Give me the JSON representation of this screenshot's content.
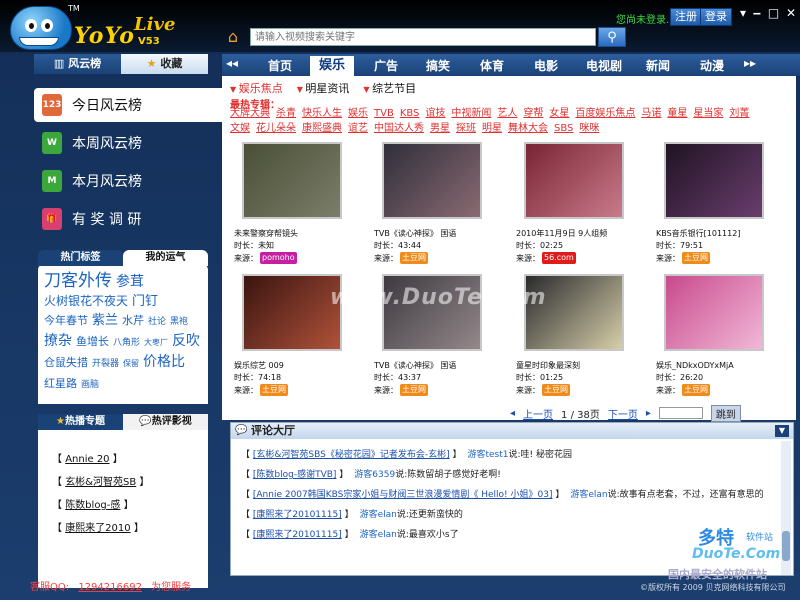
{
  "app": {
    "logo_text": "YoYo",
    "logo_live": "Live",
    "version": "V53",
    "tm": "TM"
  },
  "header": {
    "search_placeholder": "请输入视频搜索关键字",
    "login_msg": "您尚未登录...",
    "register": "注册",
    "login": "登录"
  },
  "sidebar": {
    "tabs": [
      "风云榜",
      "收藏"
    ],
    "rank_items": [
      {
        "label": "今日风云榜",
        "icon": "calendar-today-icon",
        "icon_text": "123",
        "color": "#e0683a"
      },
      {
        "label": "本周风云榜",
        "icon": "calendar-week-icon",
        "icon_text": "W",
        "color": "#3aa83a"
      },
      {
        "label": "本月风云榜",
        "icon": "calendar-month-icon",
        "icon_text": "M",
        "color": "#3aa83a"
      },
      {
        "label": "有 奖 调 研",
        "icon": "gift-icon",
        "icon_text": "🎁",
        "color": "#d84070"
      }
    ],
    "tags_tabs": [
      "热门标签",
      "我的运气"
    ],
    "tags": [
      {
        "t": "刀客外传",
        "s": 17
      },
      {
        "t": "参茸",
        "s": 14
      },
      {
        "t": "火树银花不夜天",
        "s": 12
      },
      {
        "t": "门钉",
        "s": 13
      },
      {
        "t": "今年春节",
        "s": 11
      },
      {
        "t": "紫兰",
        "s": 13
      },
      {
        "t": "水芹",
        "s": 11
      },
      {
        "t": "社论",
        "s": 9
      },
      {
        "t": "黑袍",
        "s": 9
      },
      {
        "t": "撩杂",
        "s": 14
      },
      {
        "t": "鱼增长",
        "s": 11
      },
      {
        "t": "八角形",
        "s": 9
      },
      {
        "t": "大枣厂",
        "s": 8
      },
      {
        "t": "反吹",
        "s": 14
      },
      {
        "t": "仓鼠失措",
        "s": 11
      },
      {
        "t": "开裂器",
        "s": 9
      },
      {
        "t": "保留",
        "s": 8
      },
      {
        "t": "价格比",
        "s": 14
      },
      {
        "t": "红星路",
        "s": 11
      },
      {
        "t": "画脑",
        "s": 9
      }
    ],
    "topics_tabs": [
      "热播专题",
      "热评影视"
    ],
    "topics": [
      "Annie 20",
      "玄彬&河智苑SB",
      "陈数blog-感",
      "康熙来了2010"
    ]
  },
  "status": {
    "qq_label": "客服QQ:",
    "qq": "1294216692",
    "service": "为您服务"
  },
  "copyright": "©版权所有 2009 贝克网络科技有限公司",
  "main_tabs": [
    "首页",
    "娱乐",
    "广告",
    "搞笑",
    "体育",
    "电影",
    "电视剧",
    "新闻",
    "动漫"
  ],
  "content": {
    "subtabs": [
      "娱乐焦点",
      "明星资讯",
      "综艺节目"
    ],
    "specials_label": "最热专辑：",
    "specials": [
      "大牌大典",
      "杀青",
      "快乐人生",
      "娱乐",
      "TVB",
      "KBS",
      "谊技",
      "中视新闻",
      "艺人",
      "穿帮",
      "女星",
      "百度娱乐焦点",
      "马诺",
      "童星",
      "星当家",
      "刘菁",
      "文娱",
      "花儿朵朵",
      "康熙盛典",
      "谊艺",
      "中国达人秀",
      "男星",
      "探班",
      "明星",
      "舞林大会",
      "SBS",
      "咪咪"
    ],
    "videos": [
      {
        "title": "未来警察穿帮镜头",
        "dur": "时长：未知",
        "src": "来源：",
        "logo": "pomoho",
        "colors": [
          "#4a4f36",
          "#7b7e6a"
        ]
      },
      {
        "title": "TVB《读心神探》 国语",
        "dur": "时长：43:44",
        "src": "来源：",
        "logo": "土豆网",
        "colors": [
          "#2f2f3b",
          "#8a6a72"
        ]
      },
      {
        "title": "2010年11月9日 9人组频",
        "dur": "时长：02:25",
        "src": "来源：",
        "logo": "56.com",
        "colors": [
          "#7a2434",
          "#c97b8b"
        ]
      },
      {
        "title": "KBS音乐银行[101112]",
        "dur": "时长：79:51",
        "src": "来源：",
        "logo": "土豆网",
        "colors": [
          "#1e1422",
          "#6a3d6e"
        ]
      },
      {
        "title": "娱乐综艺 009",
        "dur": "时长：74:18",
        "src": "来源：",
        "logo": "土豆网",
        "colors": [
          "#3a1410",
          "#b0523a"
        ]
      },
      {
        "title": "TVB《读心神探》 国语",
        "dur": "时长：43:37",
        "src": "来源：",
        "logo": "土豆网",
        "colors": [
          "#3d3a40",
          "#94888a"
        ]
      },
      {
        "title": "童星时印象最深刻",
        "dur": "时长：01:25",
        "src": "来源：",
        "logo": "土豆网",
        "colors": [
          "#2a2a2e",
          "#d6cfa8"
        ]
      },
      {
        "title": "娱乐_NDkxODYxMjA",
        "dur": "时长：26:20",
        "src": "来源：",
        "logo": "土豆网",
        "colors": [
          "#c84a8c",
          "#f2b8d8"
        ]
      }
    ],
    "pager": {
      "prev": "上一页",
      "info": "1 / 38页",
      "next": "下一页",
      "goto": "跳到"
    }
  },
  "comments": {
    "header": "评论大厅",
    "items": [
      {
        "topic": "[玄彬&河智苑SBS《秘密花园》记者发布会-玄彬]",
        "user": "游客test1",
        "text": "说:哇! 秘密花园"
      },
      {
        "topic": "[陈数blog-感谢TVB]",
        "user": "游客6359",
        "text": "说:陈数留胡子感觉好老啊!"
      },
      {
        "topic": "[Annie 2007韩国KBS宗家小姐与财阀三世浪漫爱情剧《 Hello! 小姐》03]",
        "user": "游客elan",
        "text": "说:故事有点老套，不过，还富有意思的"
      },
      {
        "topic": "[康熙来了20101115]",
        "user": "游客elan",
        "text": "说:还更新蛮快的"
      },
      {
        "topic": "[康熙来了20101115]",
        "user": "游客elan",
        "text": "说:最喜欢小s了"
      }
    ]
  },
  "watermarks": {
    "center": "www.DuoTe.com",
    "corner_1": "多特",
    "corner_2": "软件站",
    "corner_3": "DuoTe.Com",
    "corner_4": "国内最安全的软件站"
  }
}
